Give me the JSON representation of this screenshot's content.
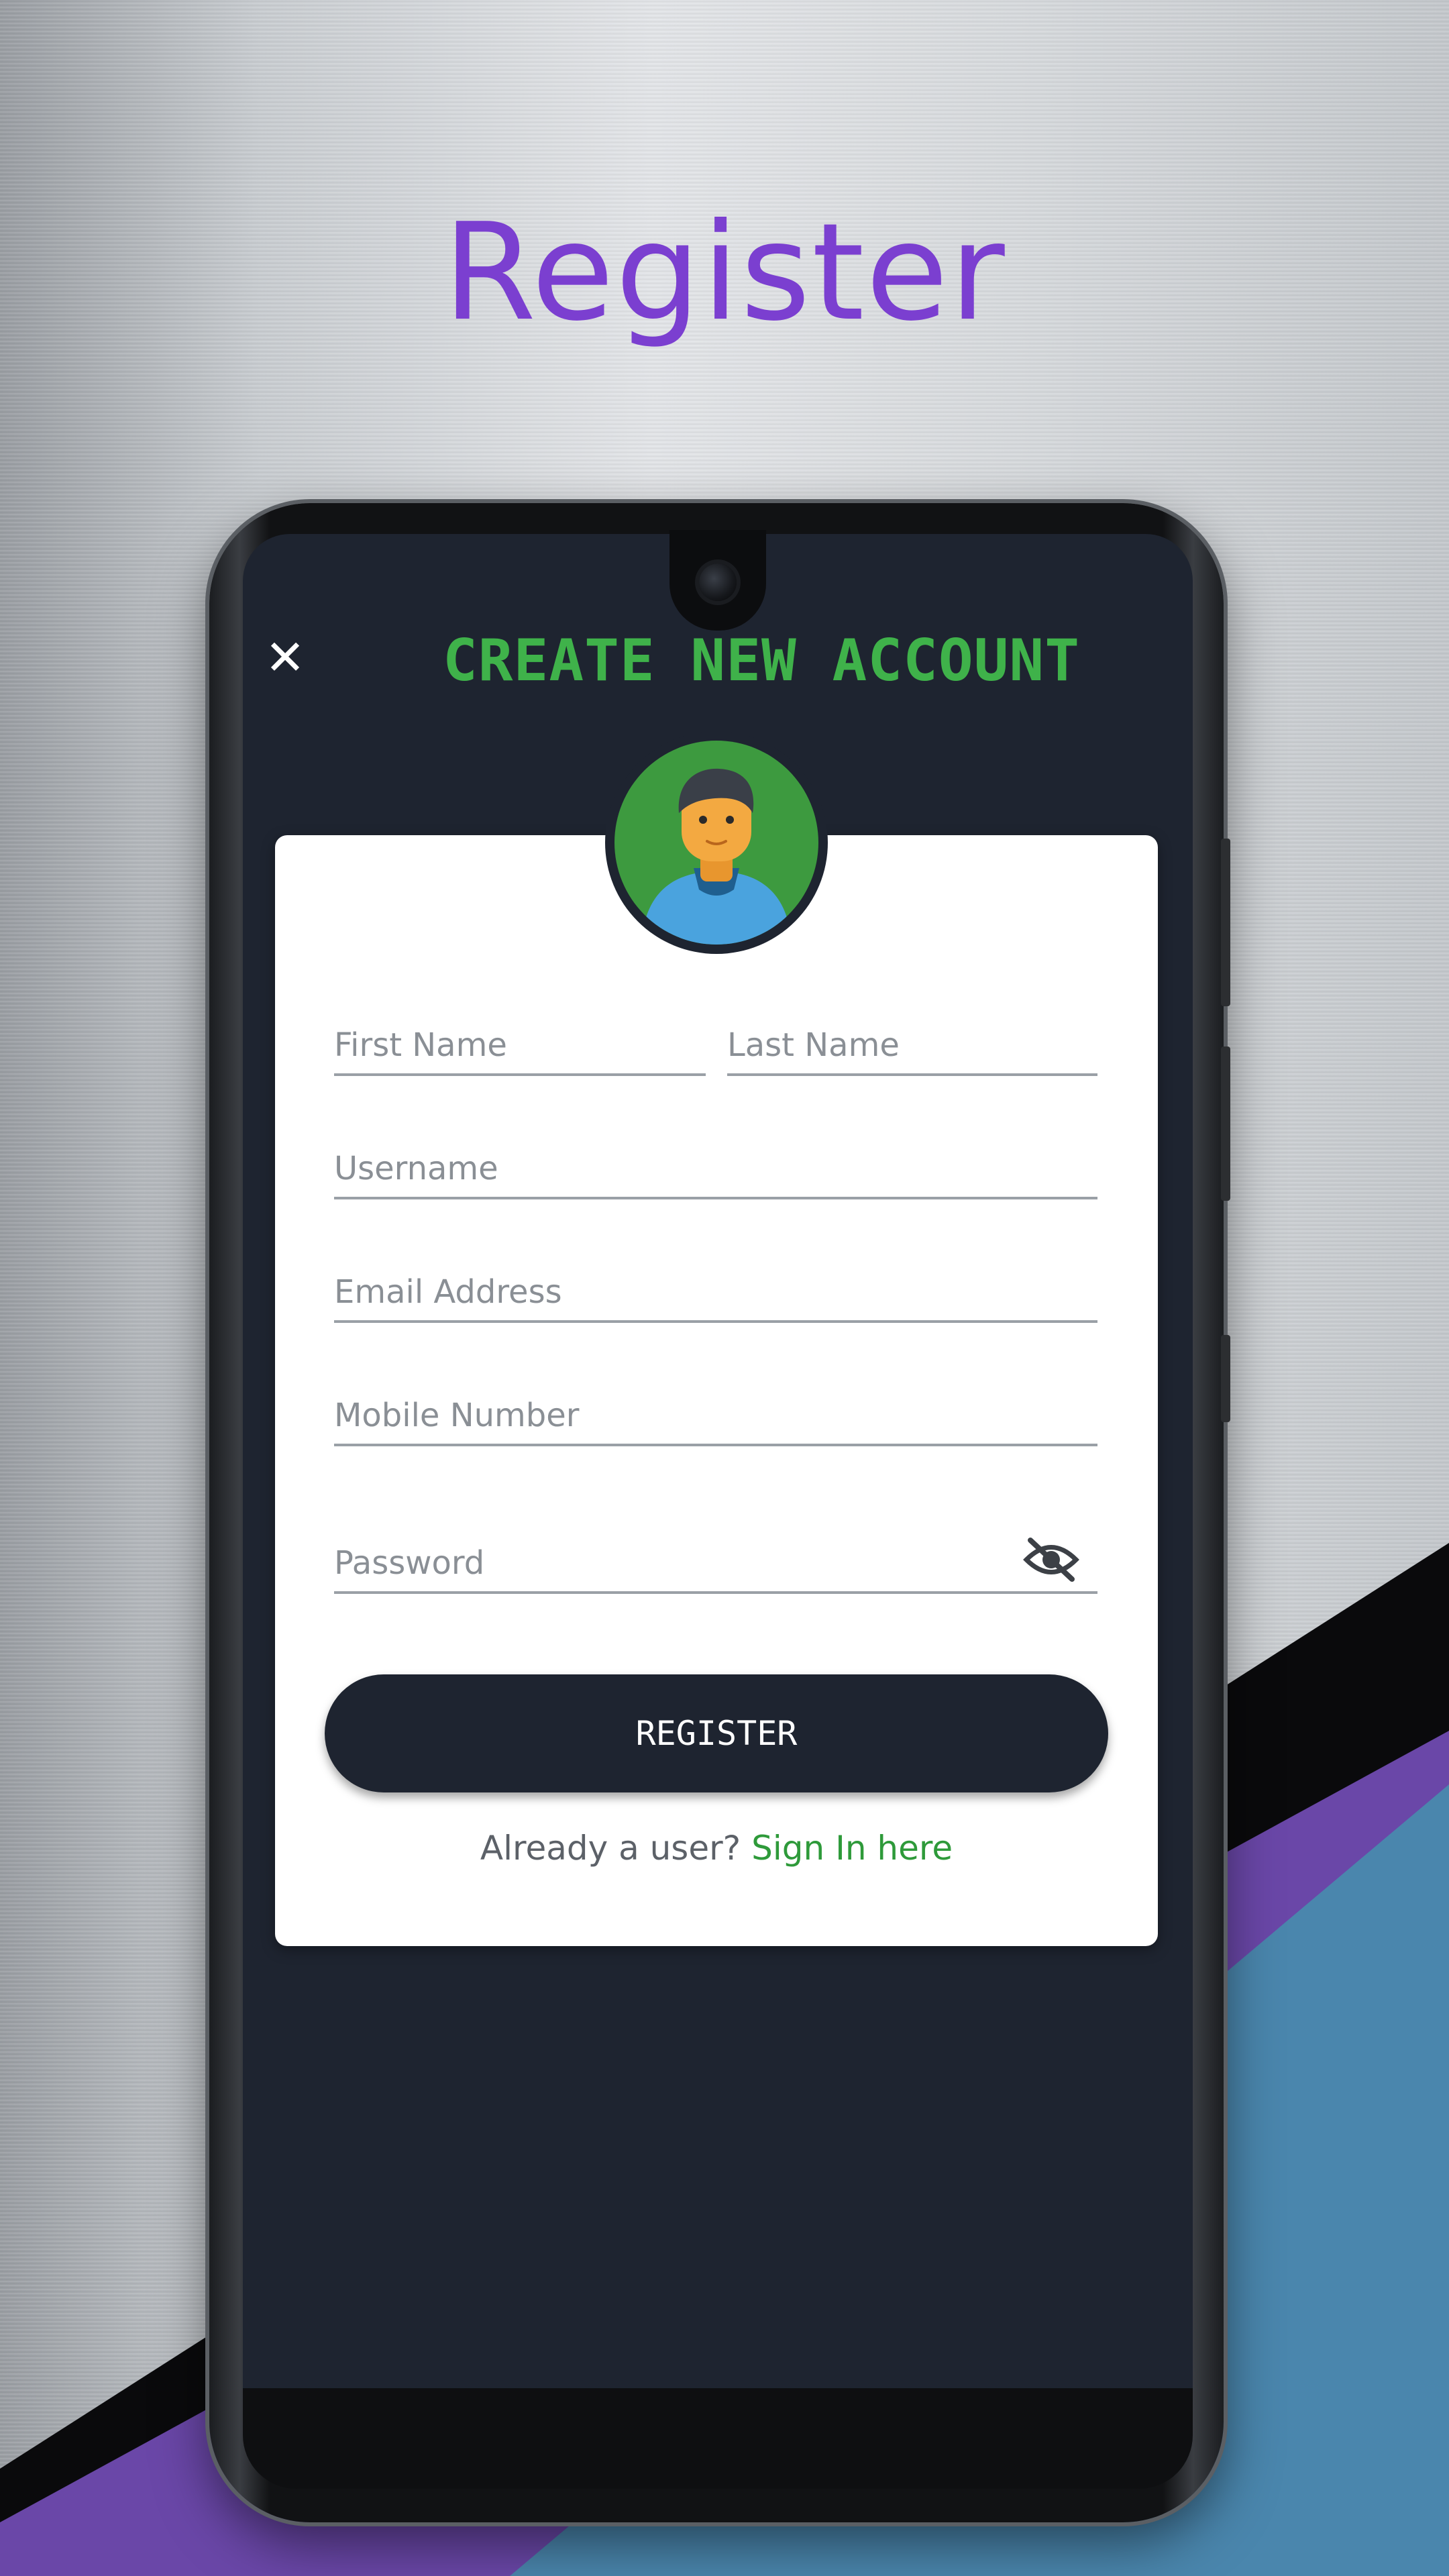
{
  "promo": {
    "title": "Register"
  },
  "screen": {
    "title": "CREATE NEW ACCOUNT",
    "close_icon": "close-icon",
    "avatar_icon": "user-avatar-icon"
  },
  "form": {
    "first_name": {
      "placeholder": "First Name",
      "value": ""
    },
    "last_name": {
      "placeholder": "Last Name",
      "value": ""
    },
    "username": {
      "placeholder": "Username",
      "value": ""
    },
    "email": {
      "placeholder": "Email Address",
      "value": ""
    },
    "mobile": {
      "placeholder": "Mobile Number",
      "value": ""
    },
    "password": {
      "placeholder": "Password",
      "value": "",
      "toggle_icon": "eye-off-icon"
    },
    "register_label": "REGISTER",
    "signin_prompt": "Already a user?",
    "signin_link": "Sign In here"
  },
  "colors": {
    "promo_title": "#7b3fd0",
    "screen_bg": "#1e2430",
    "screen_title": "#3fb24a",
    "link": "#2e9a3a",
    "button_bg": "#1e2430",
    "avatar_bg": "#3d9a3f"
  }
}
